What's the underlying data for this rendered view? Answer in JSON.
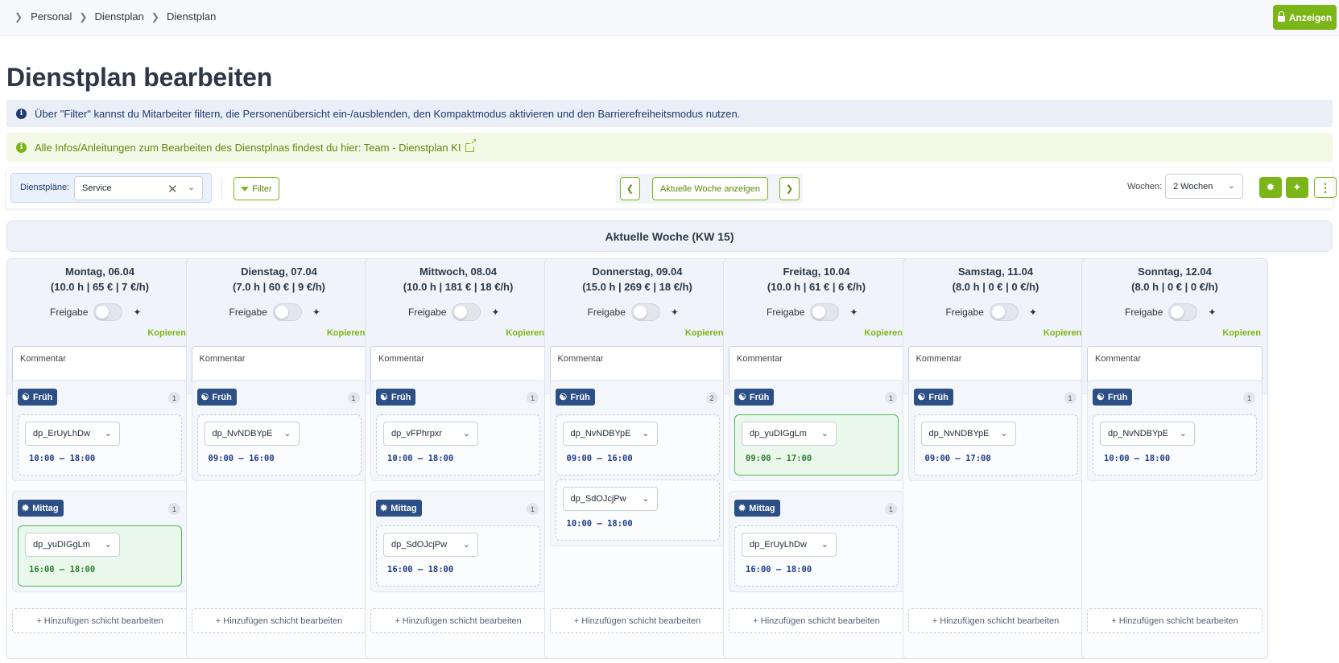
{
  "breadcrumb": [
    "Personal",
    "Dienstplan",
    "Dienstplan"
  ],
  "header": {
    "anzeigen_label": "Anzeigen"
  },
  "page_title": "Dienstplan bearbeiten",
  "info_text": "Über \"Filter\" kannst du Mitarbeiter filtern, die Personenübersicht ein-/ausblenden, den Kompaktmodus aktivieren und den Barrierefreiheitsmodus nutzen.",
  "note_text": "Alle Infos/Anleitungen zum Bearbeiten des Dienstplnas findest du hier: Team - Dienstplan KI",
  "toolbar": {
    "dienstplaene_label": "Dienstpläne:",
    "dienstplaene_value": "Service",
    "filter_label": "Filter",
    "current_week_label": "Aktuelle Woche anzeigen",
    "wochen_label": "Wochen:",
    "wochen_value": "2 Wochen"
  },
  "week_header": "Aktuelle Woche (KW 15)",
  "labels": {
    "freigabe": "Freigabe",
    "kopieren": "Kopieren",
    "kommentar": "Kommentar",
    "add": "+ Hinzufügen schicht bearbeiten"
  },
  "colors": {
    "accent": "#7cb518",
    "shift_badge": "#2b4f86",
    "approved_slot": "#e9f8ea"
  },
  "days": [
    {
      "title": "Montag, 06.04",
      "stats": "(10.0 h | 65 € | 7 €/h)",
      "shifts": [
        {
          "name": "Früh",
          "icon": "person-shift-icon",
          "count": "1",
          "slots": [
            {
              "employee": "dp_ErUyLhDw",
              "time": "10:00 – 18:00",
              "approved": false
            }
          ]
        },
        {
          "name": "Mittag",
          "icon": "sun-shift-icon",
          "count": "1",
          "slots": [
            {
              "employee": "dp_yuDIGgLm",
              "time": "16:00 – 18:00",
              "approved": true
            }
          ]
        }
      ]
    },
    {
      "title": "Dienstag, 07.04",
      "stats": "(7.0 h | 60 € | 9 €/h)",
      "shifts": [
        {
          "name": "Früh",
          "icon": "person-shift-icon",
          "count": "1",
          "slots": [
            {
              "employee": "dp_NvNDBYpE",
              "time": "09:00 – 16:00",
              "approved": false
            }
          ]
        }
      ]
    },
    {
      "title": "Mittwoch, 08.04",
      "stats": "(10.0 h | 181 € | 18 €/h)",
      "shifts": [
        {
          "name": "Früh",
          "icon": "person-shift-icon",
          "count": "1",
          "slots": [
            {
              "employee": "dp_vFPhrpxr",
              "time": "10:00 – 18:00",
              "approved": false
            }
          ]
        },
        {
          "name": "Mittag",
          "icon": "sun-shift-icon",
          "count": "1",
          "slots": [
            {
              "employee": "dp_SdOJcjPw",
              "time": "16:00 – 18:00",
              "approved": false
            }
          ]
        }
      ]
    },
    {
      "title": "Donnerstag, 09.04",
      "stats": "(15.0 h | 269 € | 18 €/h)",
      "shifts": [
        {
          "name": "Früh",
          "icon": "person-shift-icon",
          "count": "2",
          "slots": [
            {
              "employee": "dp_NvNDBYpE",
              "time": "09:00 – 16:00",
              "approved": false
            },
            {
              "employee": "dp_SdOJcjPw",
              "time": "10:00 – 18:00",
              "approved": false
            }
          ]
        }
      ]
    },
    {
      "title": "Freitag, 10.04",
      "stats": "(10.0 h | 61 € | 6 €/h)",
      "shifts": [
        {
          "name": "Früh",
          "icon": "person-shift-icon",
          "count": "1",
          "slots": [
            {
              "employee": "dp_yuDIGgLm",
              "time": "09:00 – 17:00",
              "approved": true
            }
          ]
        },
        {
          "name": "Mittag",
          "icon": "sun-shift-icon",
          "count": "1",
          "slots": [
            {
              "employee": "dp_ErUyLhDw",
              "time": "16:00 – 18:00",
              "approved": false
            }
          ]
        }
      ]
    },
    {
      "title": "Samstag, 11.04",
      "stats": "(8.0 h | 0 € | 0 €/h)",
      "shifts": [
        {
          "name": "Früh",
          "icon": "person-shift-icon",
          "count": "1",
          "slots": [
            {
              "employee": "dp_NvNDBYpE",
              "time": "09:00 – 17:00",
              "approved": false
            }
          ]
        }
      ]
    },
    {
      "title": "Sonntag, 12.04",
      "stats": "(8.0 h | 0 € | 0 €/h)",
      "shifts": [
        {
          "name": "Früh",
          "icon": "person-shift-icon",
          "count": "1",
          "slots": [
            {
              "employee": "dp_NvNDBYpE",
              "time": "10:00 – 18:00",
              "approved": false
            }
          ]
        }
      ]
    }
  ]
}
